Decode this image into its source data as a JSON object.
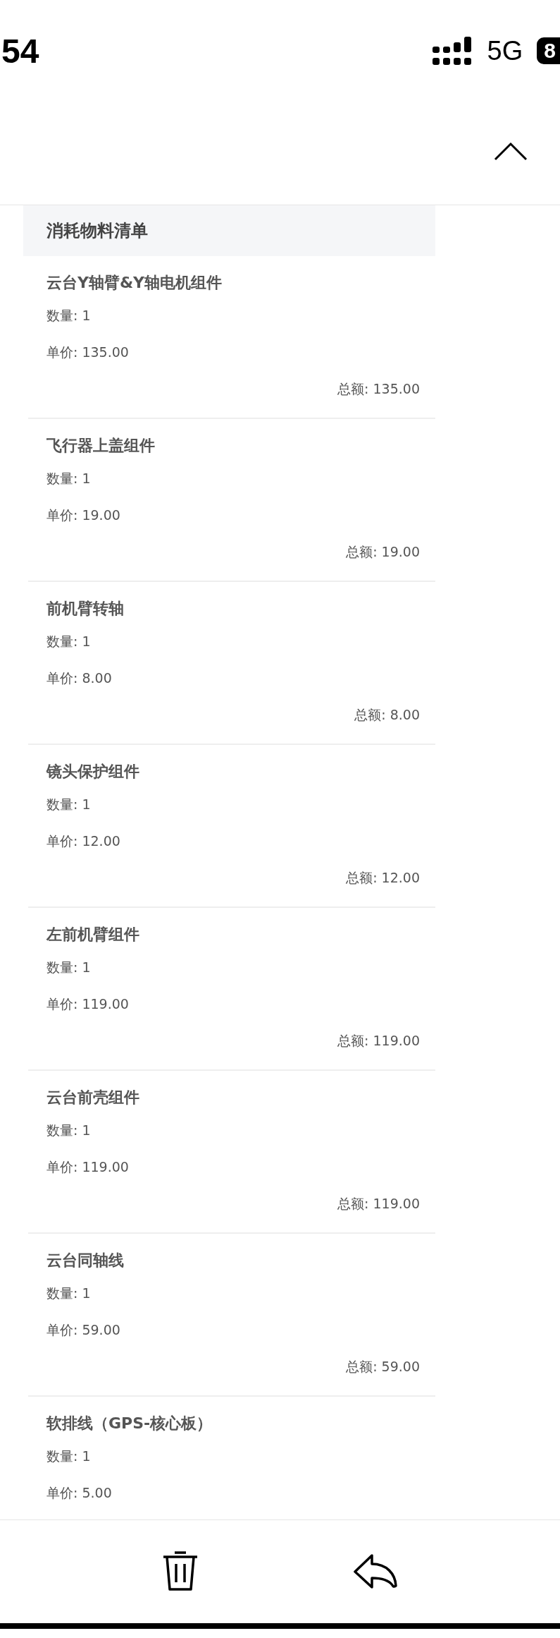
{
  "status_bar": {
    "time": "54",
    "network": "5G",
    "battery": "8"
  },
  "section": {
    "title": "消耗物料清单",
    "expanded": true
  },
  "items": [
    {
      "name": "云台Y轴臂&Y轴电机组件",
      "quantity": "数量: 1",
      "unit_price": "单价: 135.00",
      "total": "总额: 135.00"
    },
    {
      "name": "飞行器上盖组件",
      "quantity": "数量: 1",
      "unit_price": "单价: 19.00",
      "total": "总额: 19.00"
    },
    {
      "name": "前机臂转轴",
      "quantity": "数量: 1",
      "unit_price": "单价: 8.00",
      "total": "总额: 8.00"
    },
    {
      "name": "镜头保护组件",
      "quantity": "数量: 1",
      "unit_price": "单价: 12.00",
      "total": "总额: 12.00"
    },
    {
      "name": "左前机臂组件",
      "quantity": "数量: 1",
      "unit_price": "单价: 119.00",
      "total": "总额: 119.00"
    },
    {
      "name": "云台前壳组件",
      "quantity": "数量: 1",
      "unit_price": "单价: 119.00",
      "total": "总额: 119.00"
    },
    {
      "name": "云台同轴线",
      "quantity": "数量: 1",
      "unit_price": "单价: 59.00",
      "total": "总额: 59.00"
    },
    {
      "name": "软排线（GPS-核心板）",
      "quantity": "数量: 1",
      "unit_price": "单价: 5.00"
    }
  ]
}
